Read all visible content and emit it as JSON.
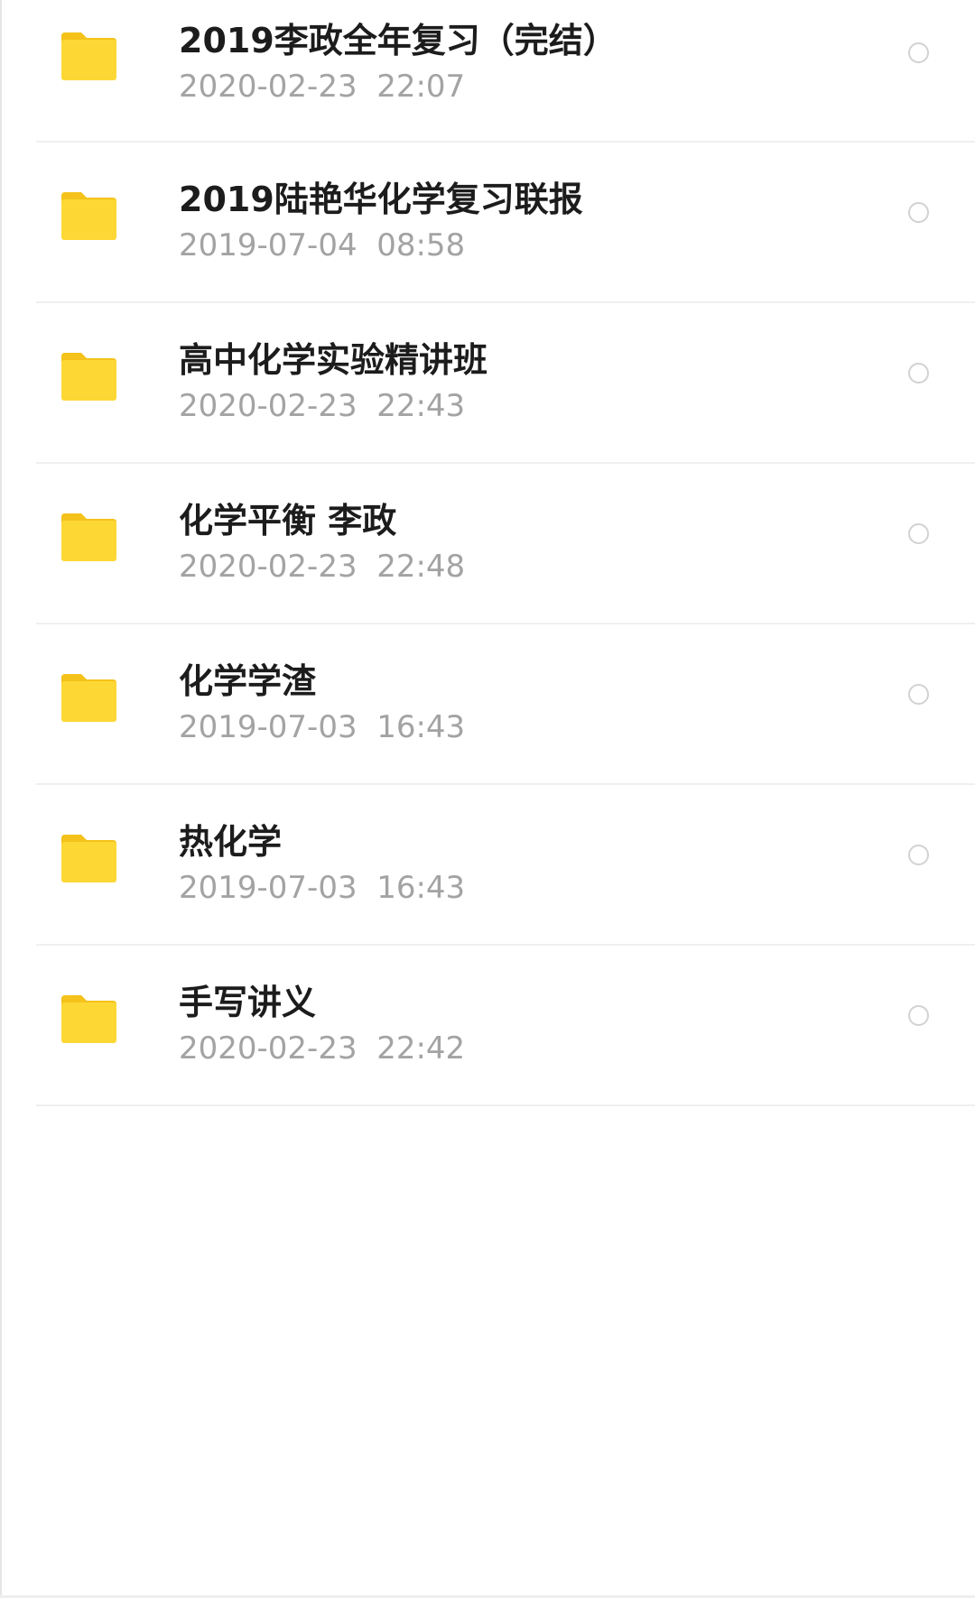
{
  "colors": {
    "folder_front": "#fdd835",
    "folder_tab": "#f4c21a",
    "name_text": "#1c1c1c",
    "date_text": "#a3a3a3",
    "divider": "#efefef",
    "radio_border": "#d2d2d2"
  },
  "icons": {
    "folder": "folder-icon",
    "select": "radio-circle"
  },
  "files": [
    {
      "name": "2019李政全年复习（完结）",
      "date": "2020-02-23  22:07"
    },
    {
      "name": "2019陆艳华化学复习联报",
      "date": "2019-07-04  08:58"
    },
    {
      "name": "高中化学实验精讲班",
      "date": "2020-02-23  22:43"
    },
    {
      "name": "化学平衡 李政",
      "date": "2020-02-23  22:48"
    },
    {
      "name": "化学学渣",
      "date": "2019-07-03  16:43"
    },
    {
      "name": "热化学",
      "date": "2019-07-03  16:43"
    },
    {
      "name": "手写讲义",
      "date": "2020-02-23  22:42"
    }
  ]
}
